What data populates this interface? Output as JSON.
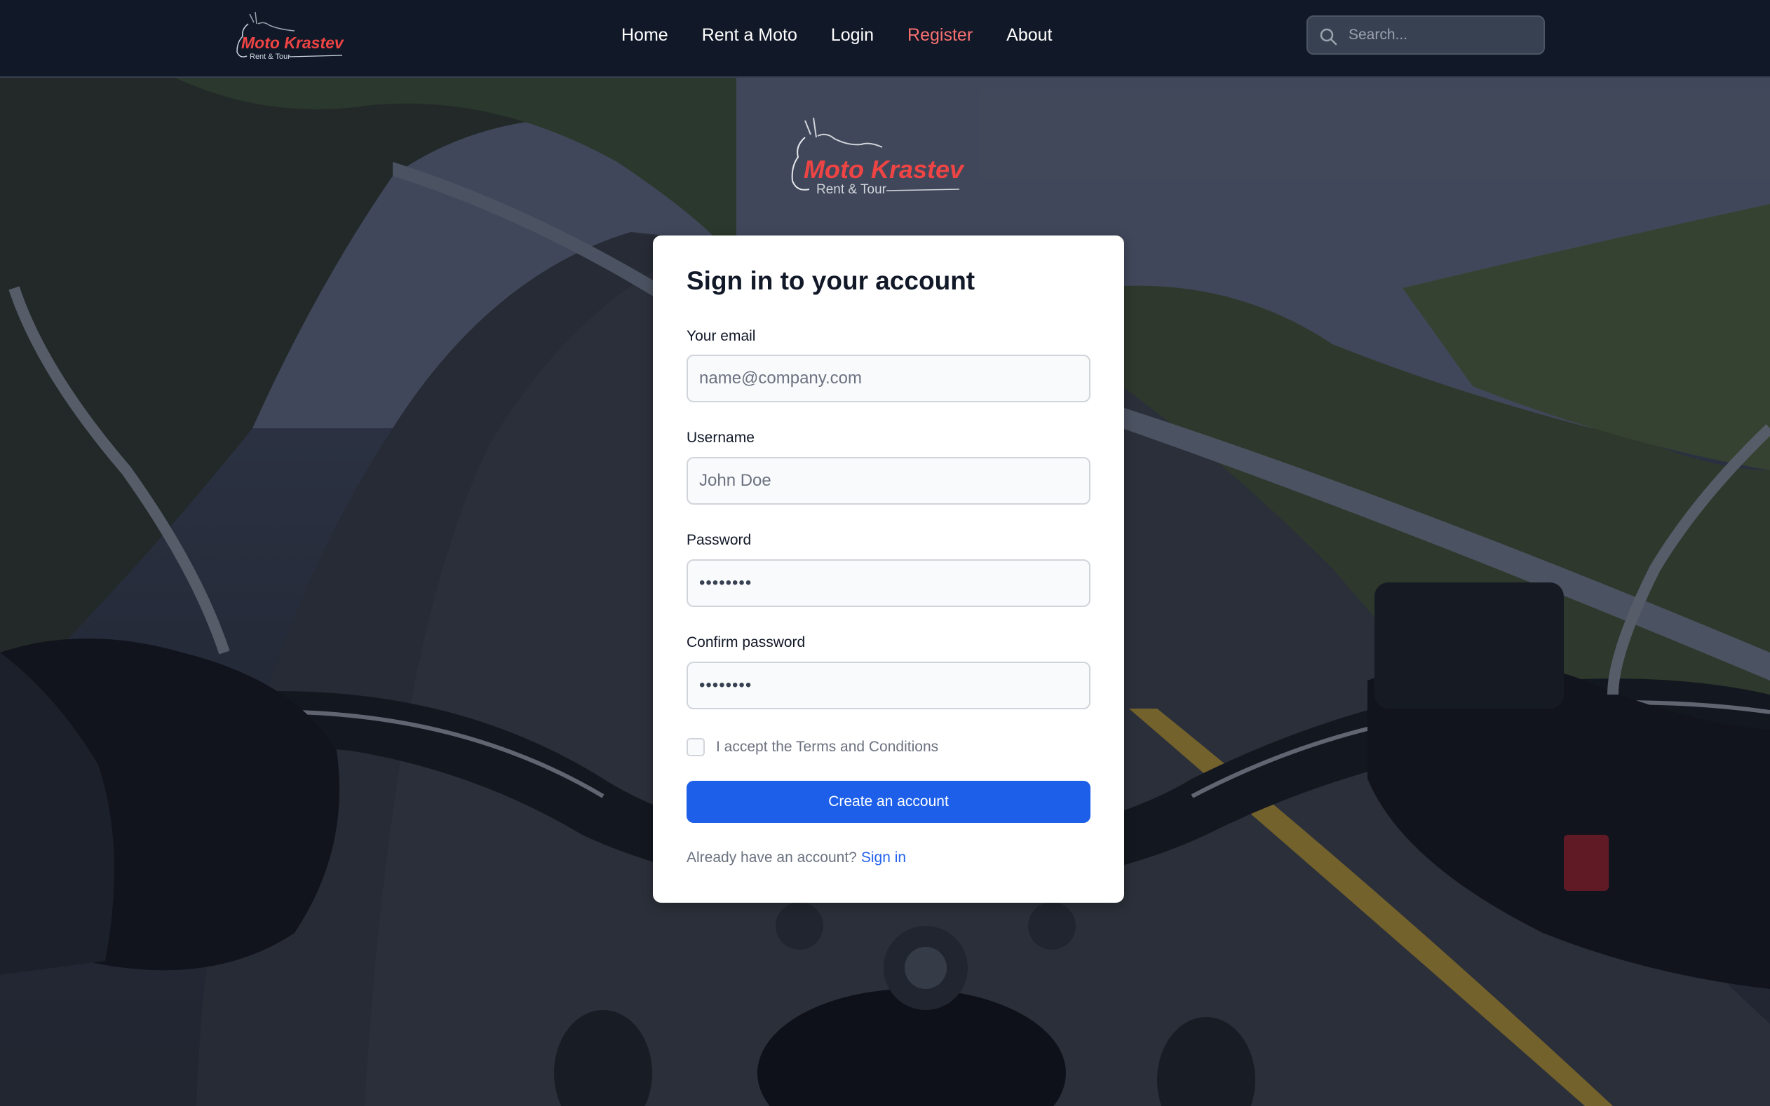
{
  "brand": {
    "name": "Moto Krastev",
    "tagline": "Rent & Tour",
    "accent_color": "#ef4444"
  },
  "nav": {
    "items": [
      {
        "label": "Home",
        "active": false
      },
      {
        "label": "Rent a Moto",
        "active": false
      },
      {
        "label": "Login",
        "active": false
      },
      {
        "label": "Register",
        "active": true
      },
      {
        "label": "About",
        "active": false
      }
    ],
    "active_color": "#f87171"
  },
  "search": {
    "placeholder": "Search...",
    "icon": "search-icon"
  },
  "form": {
    "title": "Sign in to your account",
    "email_label": "Your email",
    "email_placeholder": "name@company.com",
    "username_label": "Username",
    "username_placeholder": "John Doe",
    "password_label": "Password",
    "password_placeholder": "••••••••",
    "confirm_label": "Confirm password",
    "confirm_placeholder": "••••••••",
    "terms_label": "I accept the Terms and Conditions",
    "terms_checked": false,
    "submit_label": "Create an account",
    "signin_prompt": "Already have an account?",
    "signin_link": "Sign in",
    "button_color": "#1d5fe8"
  }
}
